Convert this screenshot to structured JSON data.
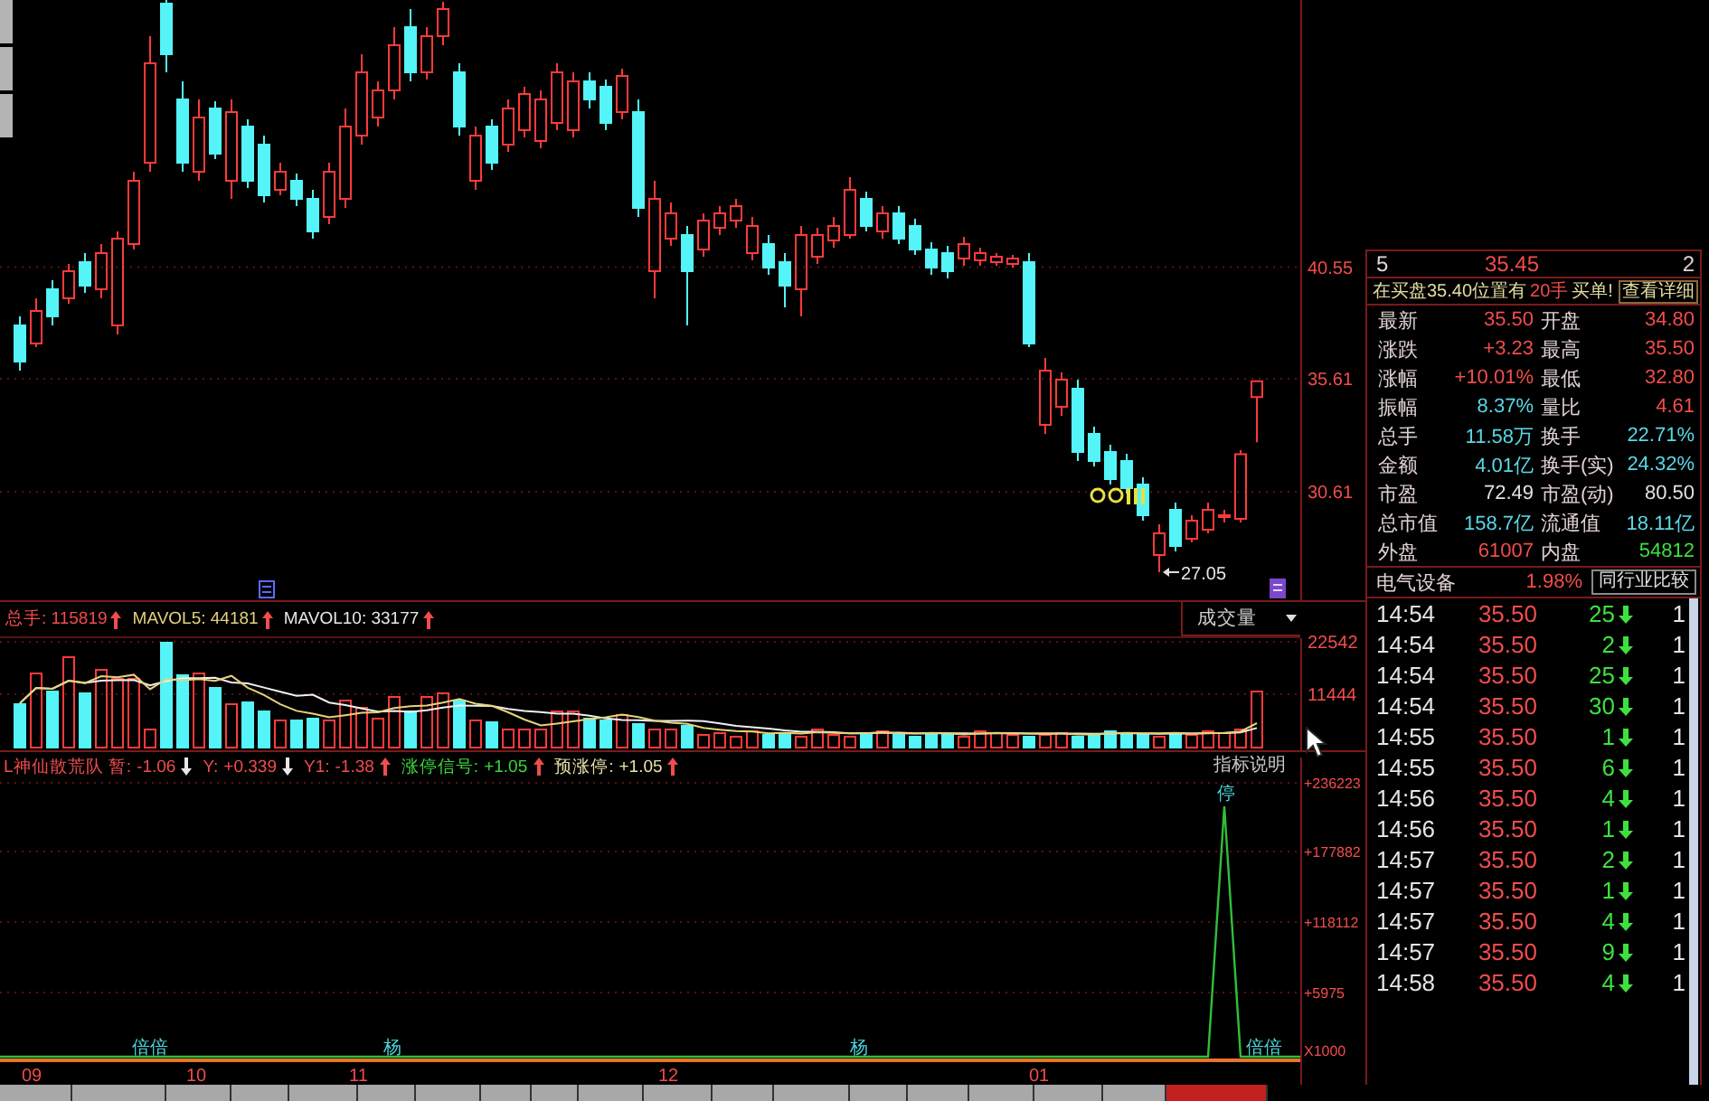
{
  "price_chart": {
    "chart_data": {
      "type": "candlestick",
      "ohlc": [
        [
          37.97,
          38.37,
          35.97,
          36.37
        ],
        [
          37.17,
          39.17,
          37.01,
          38.61
        ],
        [
          39.57,
          39.97,
          37.97,
          38.37
        ],
        [
          39.17,
          40.69,
          38.93,
          40.37
        ],
        [
          40.77,
          41.17,
          39.41,
          39.73
        ],
        [
          39.57,
          41.57,
          39.17,
          41.17
        ],
        [
          37.97,
          42.13,
          37.57,
          41.81
        ],
        [
          41.57,
          44.77,
          41.33,
          44.37
        ],
        [
          45.17,
          50.77,
          44.77,
          49.57
        ],
        [
          52.21,
          52.37,
          49.17,
          49.97
        ],
        [
          47.97,
          48.77,
          44.77,
          45.17
        ],
        [
          44.77,
          47.97,
          44.37,
          47.17
        ],
        [
          47.57,
          47.89,
          45.33,
          45.57
        ],
        [
          44.37,
          47.97,
          43.57,
          47.41
        ],
        [
          46.77,
          47.09,
          44.05,
          44.37
        ],
        [
          45.97,
          46.37,
          43.41,
          43.73
        ],
        [
          43.97,
          45.17,
          43.73,
          44.77
        ],
        [
          44.37,
          44.69,
          43.25,
          43.57
        ],
        [
          43.57,
          43.97,
          41.81,
          42.13
        ],
        [
          42.77,
          45.17,
          42.45,
          44.77
        ],
        [
          43.57,
          47.57,
          43.17,
          46.77
        ],
        [
          46.37,
          49.97,
          45.97,
          49.17
        ],
        [
          47.17,
          48.77,
          46.77,
          48.37
        ],
        [
          48.37,
          51.17,
          47.97,
          50.37
        ],
        [
          51.17,
          51.97,
          48.77,
          49.17
        ],
        [
          49.17,
          51.17,
          48.85,
          50.77
        ],
        [
          50.77,
          52.29,
          50.37,
          51.97
        ],
        [
          49.17,
          49.57,
          46.37,
          46.77
        ],
        [
          44.37,
          46.77,
          43.97,
          46.37
        ],
        [
          46.77,
          47.09,
          44.85,
          45.17
        ],
        [
          45.97,
          47.97,
          45.65,
          47.57
        ],
        [
          46.61,
          48.53,
          46.29,
          48.21
        ],
        [
          46.13,
          48.37,
          45.81,
          47.97
        ],
        [
          46.93,
          49.57,
          46.61,
          49.17
        ],
        [
          46.61,
          49.17,
          46.29,
          48.77
        ],
        [
          48.77,
          49.17,
          47.57,
          47.97
        ],
        [
          48.53,
          48.85,
          46.61,
          46.93
        ],
        [
          47.41,
          49.33,
          47.09,
          49.01
        ],
        [
          47.41,
          47.97,
          42.77,
          43.17
        ],
        [
          40.37,
          44.37,
          39.17,
          43.57
        ],
        [
          41.81,
          43.41,
          41.49,
          42.93
        ],
        [
          41.97,
          42.37,
          37.97,
          40.37
        ],
        [
          41.33,
          42.93,
          41.01,
          42.61
        ],
        [
          42.29,
          43.25,
          41.97,
          42.93
        ],
        [
          42.61,
          43.57,
          42.29,
          43.25
        ],
        [
          41.17,
          42.77,
          40.85,
          42.37
        ],
        [
          41.57,
          41.97,
          40.21,
          40.53
        ],
        [
          40.77,
          41.17,
          38.77,
          39.73
        ],
        [
          39.57,
          42.37,
          38.37,
          41.97
        ],
        [
          41.01,
          42.29,
          40.69,
          41.97
        ],
        [
          41.73,
          42.77,
          41.41,
          42.37
        ],
        [
          41.97,
          44.53,
          41.81,
          43.97
        ],
        [
          43.57,
          43.89,
          42.13,
          42.37
        ],
        [
          42.13,
          43.25,
          41.81,
          42.93
        ],
        [
          42.93,
          43.25,
          41.57,
          41.81
        ],
        [
          42.37,
          42.69,
          41.09,
          41.33
        ],
        [
          41.33,
          41.65,
          40.21,
          40.53
        ],
        [
          41.17,
          41.49,
          40.05,
          40.37
        ],
        [
          40.93,
          41.89,
          40.61,
          41.57
        ],
        [
          40.85,
          41.41,
          40.61,
          41.17
        ],
        [
          40.77,
          41.17,
          40.61,
          41.01
        ],
        [
          40.69,
          41.09,
          40.53,
          40.93
        ],
        [
          40.77,
          41.17,
          37.01,
          37.17
        ],
        [
          33.57,
          36.53,
          33.17,
          35.97
        ],
        [
          34.37,
          35.89,
          33.97,
          35.57
        ],
        [
          35.17,
          35.57,
          31.97,
          32.37
        ],
        [
          33.17,
          33.49,
          31.73,
          31.97
        ],
        [
          32.37,
          32.69,
          30.93,
          31.17
        ],
        [
          31.97,
          32.29,
          30.53,
          30.77
        ],
        [
          30.93,
          31.25,
          29.33,
          29.57
        ],
        [
          27.81,
          29.17,
          27.05,
          28.77
        ],
        [
          29.81,
          30.13,
          27.97,
          28.21
        ],
        [
          28.53,
          29.57,
          28.37,
          29.33
        ],
        [
          28.93,
          30.13,
          28.77,
          29.81
        ],
        [
          29.49,
          29.81,
          29.25,
          29.57
        ],
        [
          29.41,
          32.45,
          29.25,
          32.27
        ],
        [
          34.8,
          35.5,
          32.8,
          35.5
        ]
      ],
      "ylim": [
        25.73,
        52.37
      ],
      "yticks": [
        {
          "value": 40.55,
          "label": "40.55"
        },
        {
          "value": 35.61,
          "label": "35.61"
        },
        {
          "value": 30.61,
          "label": "30.61"
        }
      ],
      "grid": true,
      "annotations": [
        "27.05"
      ]
    }
  },
  "volume_chart": {
    "legend": [
      {
        "text": "总手: 115819",
        "rising": true,
        "color": "#f24c4c"
      },
      {
        "text": "MAVOL5: 44181",
        "rising": true,
        "color": "#e6d27a"
      },
      {
        "text": "MAVOL10: 33177",
        "rising": true,
        "color": "#e8e8e8"
      }
    ],
    "selector": "成交量",
    "axis_labels": [
      "22542",
      "11444"
    ]
  },
  "indicator_chart": {
    "legend": [
      {
        "label": "L神仙散荒队 暂:",
        "value": "-1.06",
        "rising": false,
        "color": "#f24c4c"
      },
      {
        "label": "Y:",
        "value": "+0.339",
        "rising": false,
        "color": "#f24c4c"
      },
      {
        "label": "Y1:",
        "value": "-1.38",
        "rising": true,
        "color": "#f24c4c"
      },
      {
        "label": "涨停信号:",
        "value": "+1.05",
        "rising": true,
        "color": "#3ad83a"
      },
      {
        "label": "预涨停:",
        "value": "+1.05",
        "rising": true,
        "color": "#e8e2a8"
      }
    ],
    "help_button": "指标说明",
    "axis_labels": [
      "+236223",
      "+177882",
      "+118112",
      "+5975",
      "X1000"
    ],
    "peak_label": "停",
    "signal_labels": [
      "倍倍",
      "杨",
      "杨",
      "倍倍"
    ]
  },
  "date_axis": [
    "09",
    "10",
    "11",
    "12",
    "01"
  ],
  "quote_panel": {
    "order_row": {
      "column_1": "5",
      "price": "35.45",
      "column_3": "2"
    },
    "notice": {
      "text": "在买盘35.40位置有",
      "amount": "20手",
      "suffix": "买单!",
      "link": "查看详细"
    },
    "stats": [
      {
        "label": "最新",
        "value": "35.50",
        "color": "#f24c4c"
      },
      {
        "label": "开盘",
        "value": "34.80",
        "color": "#f24c4c"
      },
      {
        "label": "涨跌",
        "value": "+3.23",
        "color": "#f24c4c"
      },
      {
        "label": "最高",
        "value": "35.50",
        "color": "#f24c4c"
      },
      {
        "label": "涨幅",
        "value": "+10.01%",
        "color": "#f24c4c"
      },
      {
        "label": "最低",
        "value": "32.80",
        "color": "#f24c4c"
      },
      {
        "label": "振幅",
        "value": "8.37%",
        "color": "#5ad8e6"
      },
      {
        "label": "量比",
        "value": "4.61",
        "color": "#f24c4c"
      },
      {
        "label": "总手",
        "value": "11.58万",
        "color": "#5ad8e6"
      },
      {
        "label": "换手",
        "value": "22.71%",
        "color": "#5ad8e6"
      },
      {
        "label": "金额",
        "value": "4.01亿",
        "color": "#5ad8e6"
      },
      {
        "label": "换手(实)",
        "value": "24.32%",
        "color": "#5ad8e6"
      },
      {
        "label": "市盈",
        "value": "72.49",
        "color": "#e0e0e0"
      },
      {
        "label": "市盈(动)",
        "value": "80.50",
        "color": "#e0e0e0"
      },
      {
        "label": "总市值",
        "value": "158.7亿",
        "color": "#5ad8e6"
      },
      {
        "label": "流通值",
        "value": "18.11亿",
        "color": "#5ad8e6"
      },
      {
        "label": "外盘",
        "value": "61007",
        "color": "#f24c4c"
      },
      {
        "label": "内盘",
        "value": "54812",
        "color": "#3ee03e"
      }
    ],
    "industry": {
      "name": "电气设备",
      "change": "1.98%",
      "button": "同行业比较"
    },
    "trades": [
      {
        "time": "14:54",
        "price": "35.50",
        "volume": "25",
        "sell": true,
        "column_4": "1"
      },
      {
        "time": "14:54",
        "price": "35.50",
        "volume": "2",
        "sell": true,
        "column_4": "1"
      },
      {
        "time": "14:54",
        "price": "35.50",
        "volume": "25",
        "sell": true,
        "column_4": "1"
      },
      {
        "time": "14:54",
        "price": "35.50",
        "volume": "30",
        "sell": true,
        "column_4": "1"
      },
      {
        "time": "14:55",
        "price": "35.50",
        "volume": "1",
        "sell": true,
        "column_4": "1"
      },
      {
        "time": "14:55",
        "price": "35.50",
        "volume": "6",
        "sell": true,
        "column_4": "1"
      },
      {
        "time": "14:56",
        "price": "35.50",
        "volume": "4",
        "sell": true,
        "column_4": "1"
      },
      {
        "time": "14:56",
        "price": "35.50",
        "volume": "1",
        "sell": true,
        "column_4": "1"
      },
      {
        "time": "14:57",
        "price": "35.50",
        "volume": "2",
        "sell": true,
        "column_4": "1"
      },
      {
        "time": "14:57",
        "price": "35.50",
        "volume": "1",
        "sell": true,
        "column_4": "1"
      },
      {
        "time": "14:57",
        "price": "35.50",
        "volume": "4",
        "sell": true,
        "column_4": "1"
      },
      {
        "time": "14:57",
        "price": "35.50",
        "volume": "9",
        "sell": true,
        "column_4": "1"
      },
      {
        "time": "14:58",
        "price": "35.50",
        "volume": "4",
        "sell": true,
        "column_4": "1"
      }
    ]
  },
  "bottom_tabs": [
    {
      "selected": false
    },
    {
      "selected": false
    },
    {
      "selected": false
    },
    {
      "selected": false
    },
    {
      "selected": false
    },
    {
      "selected": false
    },
    {
      "selected": false
    },
    {
      "selected": false
    },
    {
      "selected": false
    },
    {
      "selected": false
    },
    {
      "selected": false
    },
    {
      "selected": false
    },
    {
      "selected": false
    },
    {
      "selected": false
    },
    {
      "selected": false
    },
    {
      "selected": false
    },
    {
      "selected": false
    },
    {
      "selected": false
    },
    {
      "selected": true
    }
  ]
}
